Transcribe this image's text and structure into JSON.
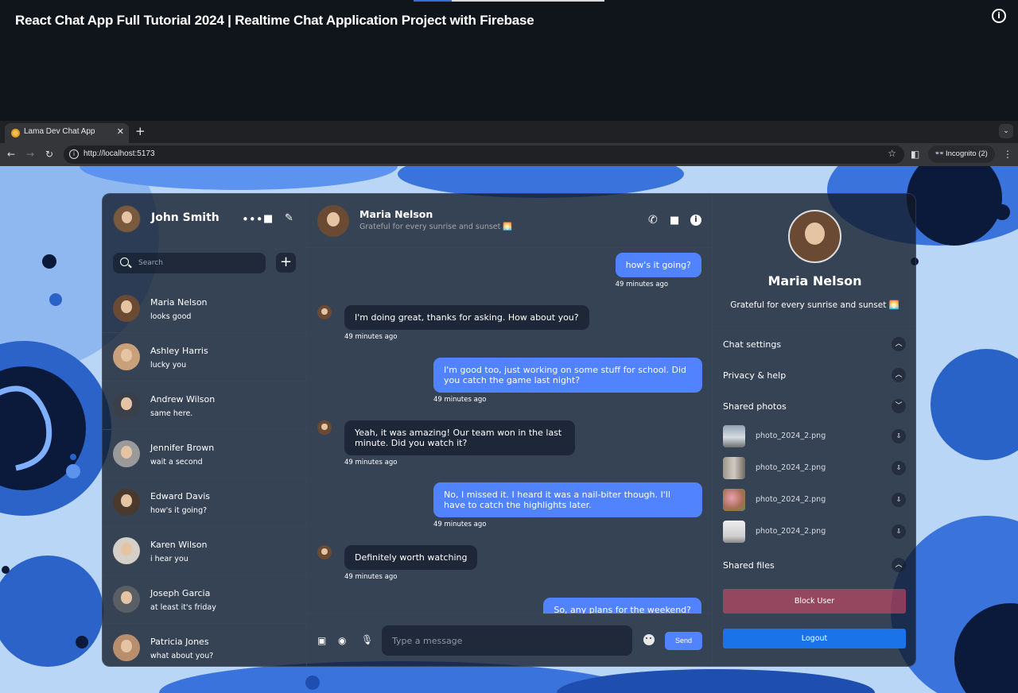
{
  "video": {
    "title": "React Chat App Full Tutorial 2024 | Realtime Chat Application Project with Firebase",
    "info_icon": "info-icon"
  },
  "browser": {
    "tab_title": "Lama Dev Chat App",
    "url": "http://localhost:5173",
    "incognito_label": "Incognito (2)"
  },
  "user": {
    "name": "John Smith",
    "icons": [
      "more-icon",
      "video-icon",
      "edit-icon"
    ]
  },
  "search": {
    "placeholder": "Search",
    "add_label": "+"
  },
  "chats": [
    {
      "name": "Maria Nelson",
      "last_message": "looks good"
    },
    {
      "name": "Ashley Harris",
      "last_message": "lucky you"
    },
    {
      "name": "Andrew Wilson",
      "last_message": "same here."
    },
    {
      "name": "Jennifer Brown",
      "last_message": "wait a second"
    },
    {
      "name": "Edward Davis",
      "last_message": "how's it going?"
    },
    {
      "name": "Karen Wilson",
      "last_message": "i hear you"
    },
    {
      "name": "Joseph Garcia",
      "last_message": "at least it's friday"
    },
    {
      "name": "Patricia Jones",
      "last_message": "what about you?"
    }
  ],
  "chat": {
    "contact_name": "Maria Nelson",
    "contact_status": "Grateful for every sunrise and sunset 🌅",
    "messages": [
      {
        "own": true,
        "text": "how's it going?",
        "time": "49 minutes ago"
      },
      {
        "own": false,
        "text": "I'm doing great, thanks for asking. How about you?",
        "time": "49 minutes ago"
      },
      {
        "own": true,
        "text": "I'm good too, just working on some stuff for school. Did you catch the game last night?",
        "time": "49 minutes ago"
      },
      {
        "own": false,
        "text": "Yeah, it was amazing! Our team won in the last minute. Did you watch it?",
        "time": "49 minutes ago"
      },
      {
        "own": true,
        "text": "No, I missed it. I heard it was a nail-biter though. I'll have to catch the highlights later.",
        "time": "49 minutes ago"
      },
      {
        "own": false,
        "text": "Definitely worth watching",
        "time": "49 minutes ago"
      },
      {
        "own": true,
        "text": "So, any plans for the weekend?",
        "time": ""
      }
    ],
    "input_placeholder": "Type a message",
    "send_label": "Send"
  },
  "detail": {
    "name": "Maria Nelson",
    "status": "Grateful for every sunrise and sunset 🌅",
    "options": {
      "chat_settings": "Chat settings",
      "privacy_help": "Privacy & help",
      "shared_photos": "Shared photos",
      "shared_files": "Shared files"
    },
    "photos": [
      {
        "name": "photo_2024_2.png"
      },
      {
        "name": "photo_2024_2.png"
      },
      {
        "name": "photo_2024_2.png"
      },
      {
        "name": "photo_2024_2.png"
      }
    ],
    "block_label": "Block User",
    "logout_label": "Logout"
  },
  "colors": {
    "accent": "#5183fe",
    "logout": "#1a73e8",
    "block": "#e64a69"
  }
}
